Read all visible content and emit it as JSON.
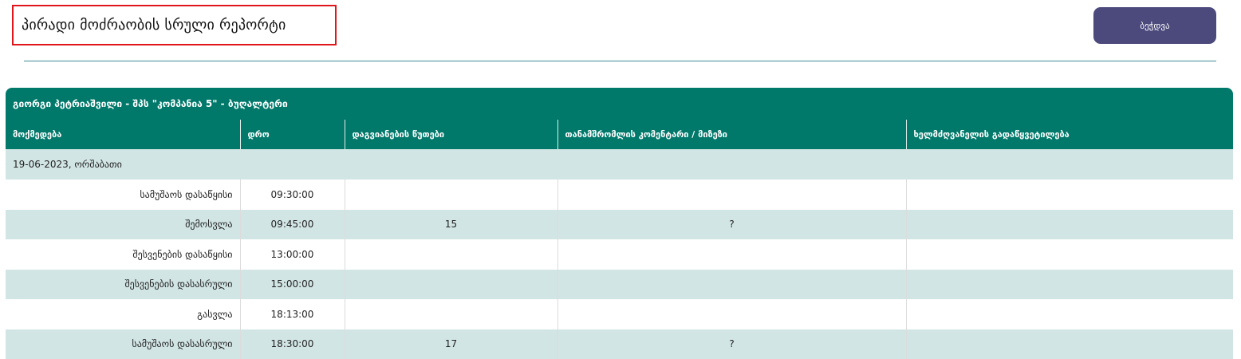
{
  "page": {
    "title": "პირადი მოძრაობის სრული რეპორტი",
    "print_label": "ბეჭდვა"
  },
  "report": {
    "header": "გიორგი პეტრიაშვილი - შპს \"კომპანია 5\" - ბუღალტერი",
    "columns": [
      "მოქმედება",
      "დრო",
      "დაგვიანების წუთები",
      "თანამშრომლის კომენტარი / მიზეზი",
      "ხელმძღვანელის გადაწყვეტილება"
    ],
    "date": "19-06-2023, ორშაბათი",
    "rows": [
      {
        "action": "სამუშაოს დასაწყისი",
        "time": "09:30:00",
        "delay": "",
        "comment": "",
        "decision": ""
      },
      {
        "action": "შემოსვლა",
        "time": "09:45:00",
        "delay": "15",
        "comment": "?",
        "decision": ""
      },
      {
        "action": "შესვენების დასაწყისი",
        "time": "13:00:00",
        "delay": "",
        "comment": "",
        "decision": ""
      },
      {
        "action": "შესვენების დასასრული",
        "time": "15:00:00",
        "delay": "",
        "comment": "",
        "decision": ""
      },
      {
        "action": "გასვლა",
        "time": "18:13:00",
        "delay": "",
        "comment": "",
        "decision": ""
      },
      {
        "action": "სამუშაოს დასასრული",
        "time": "18:30:00",
        "delay": "17",
        "comment": "?",
        "decision": ""
      }
    ]
  }
}
